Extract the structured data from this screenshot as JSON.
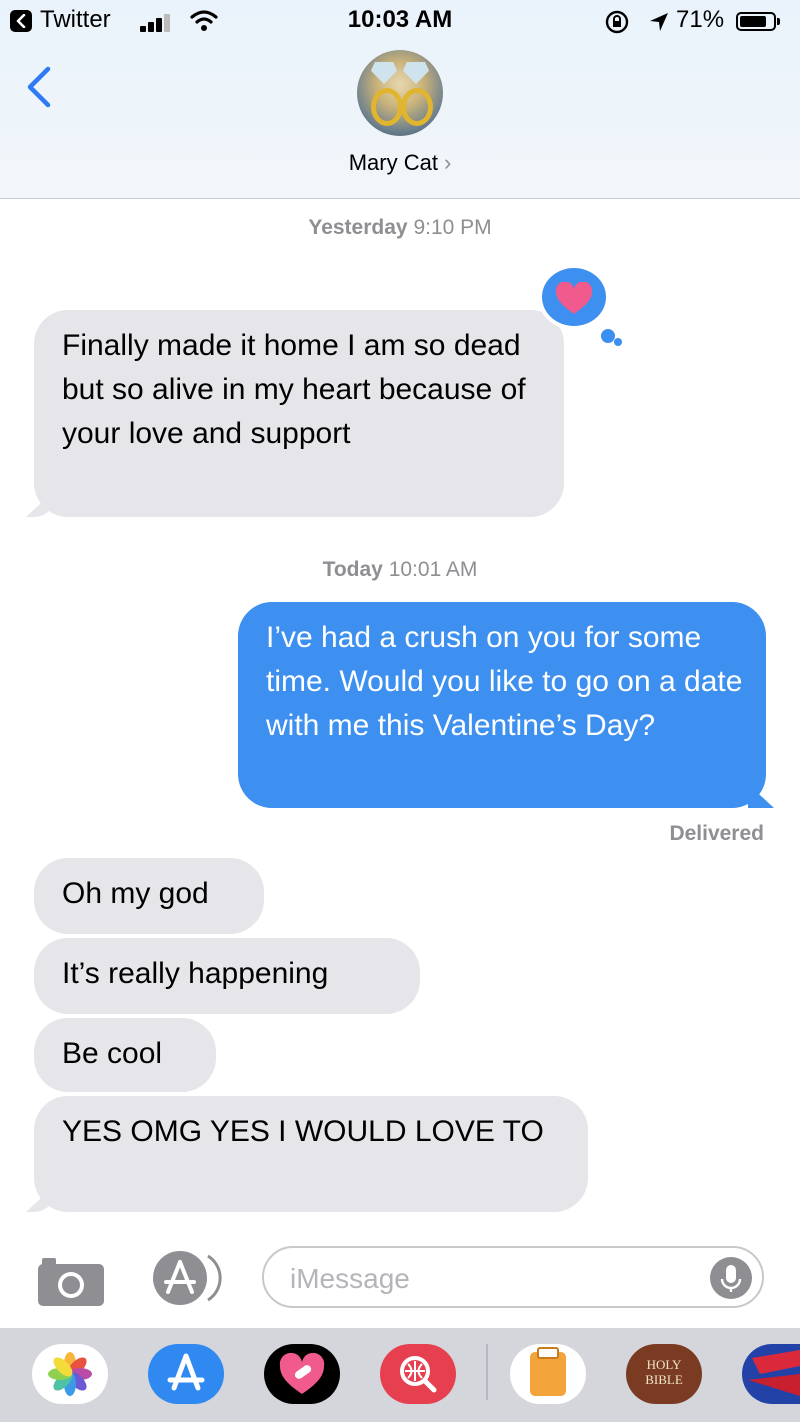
{
  "status_bar": {
    "back_app": "Twitter",
    "time": "10:03 AM",
    "battery": "71%"
  },
  "header": {
    "contact_name": "Mary Cat",
    "chevron": "›"
  },
  "messages": {
    "ts1_day": "Yesterday",
    "ts1_time": "9:10 PM",
    "m1": "Finally made it home I am so dead but so alive in my heart because of your love and support",
    "ts2_day": "Today",
    "ts2_time": "10:01 AM",
    "m2": "I’ve had a crush on you for some time. Would you like to go on a date with me this Valentine’s Day?",
    "delivered": "Delivered",
    "m3": "Oh my god",
    "m4": "It’s really happening",
    "m5": "Be cool",
    "m6": "YES OMG YES I WOULD LOVE TO"
  },
  "input": {
    "placeholder": "iMessage"
  },
  "drawer": {
    "bible_label_1": "HOLY",
    "bible_label_2": "BIBLE",
    "icons": [
      "photos-app-icon",
      "app-store-icon",
      "digital-touch-icon",
      "image-search-icon",
      "music-app-icon",
      "bible-app-icon",
      "game-app-icon"
    ]
  },
  "colors": {
    "bubble_incoming": "#e5e5ea",
    "bubble_outgoing": "#3d8ff0",
    "secondary_text": "#8e8e93",
    "heart": "#f05a8c"
  }
}
